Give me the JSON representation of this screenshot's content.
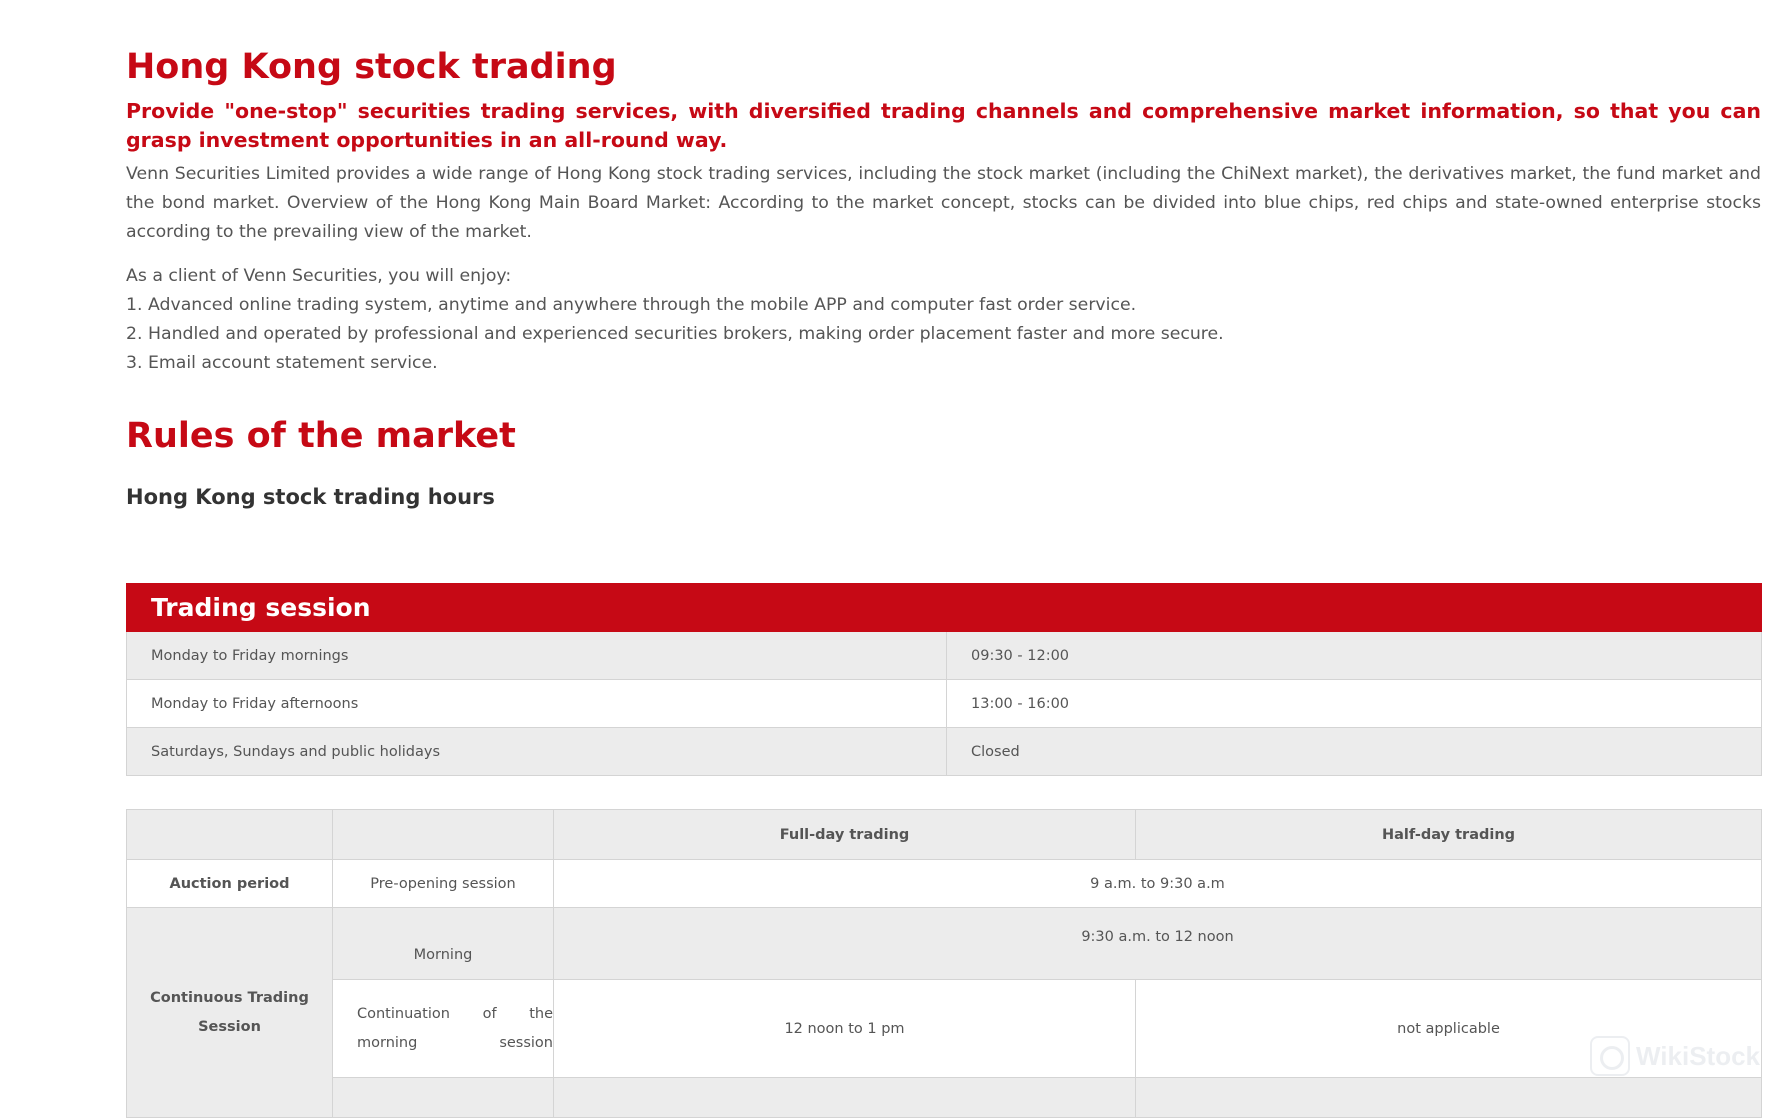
{
  "intro": {
    "title": "Hong Kong stock trading",
    "lead": "Provide \"one-stop\" securities trading services, with diversified trading channels and comprehensive market information, so that you can grasp investment opportunities in an all-round way.",
    "paragraph": "Venn Securities Limited provides a wide range of Hong Kong stock trading services, including the stock market (including the ChiNext market), the derivatives market, the fund market and the bond market. Overview of the Hong Kong Main Board Market: According to the market concept, stocks can be divided into blue chips, red chips and state-owned enterprise stocks according to the prevailing view of the market.",
    "client_line": "As a client of Venn Securities, you will enjoy:",
    "benefits": [
      "1. Advanced online trading system, anytime and anywhere through the mobile APP and computer fast order service.",
      "2. Handled and operated by professional and experienced securities brokers, making order placement faster and more secure.",
      "3. Email account statement service."
    ]
  },
  "rules": {
    "title": "Rules of the market",
    "subtitle": "Hong Kong stock trading hours"
  },
  "session_table": {
    "header": "Trading session",
    "rows": [
      {
        "day": "Monday to Friday mornings",
        "time": "09:30 - 12:00"
      },
      {
        "day": "Monday to Friday afternoons",
        "time": "13:00 - 16:00"
      },
      {
        "day": "Saturdays, Sundays and public holidays",
        "time": "Closed"
      }
    ]
  },
  "detail_table": {
    "col_full": "Full-day trading",
    "col_half": "Half-day trading",
    "auction_label": "Auction period",
    "pre_opening": "Pre-opening session",
    "pre_opening_time": "9 a.m. to 9:30 a.m",
    "continuous_label": "Continuous Trading Session",
    "morning": "Morning",
    "morning_time": "9:30 a.m. to 12 noon",
    "continuation": "Continuation of the morning session",
    "continuation_full": "12 noon to 1 pm",
    "continuation_half": "not applicable"
  },
  "watermark": {
    "text": "WikiStock"
  }
}
